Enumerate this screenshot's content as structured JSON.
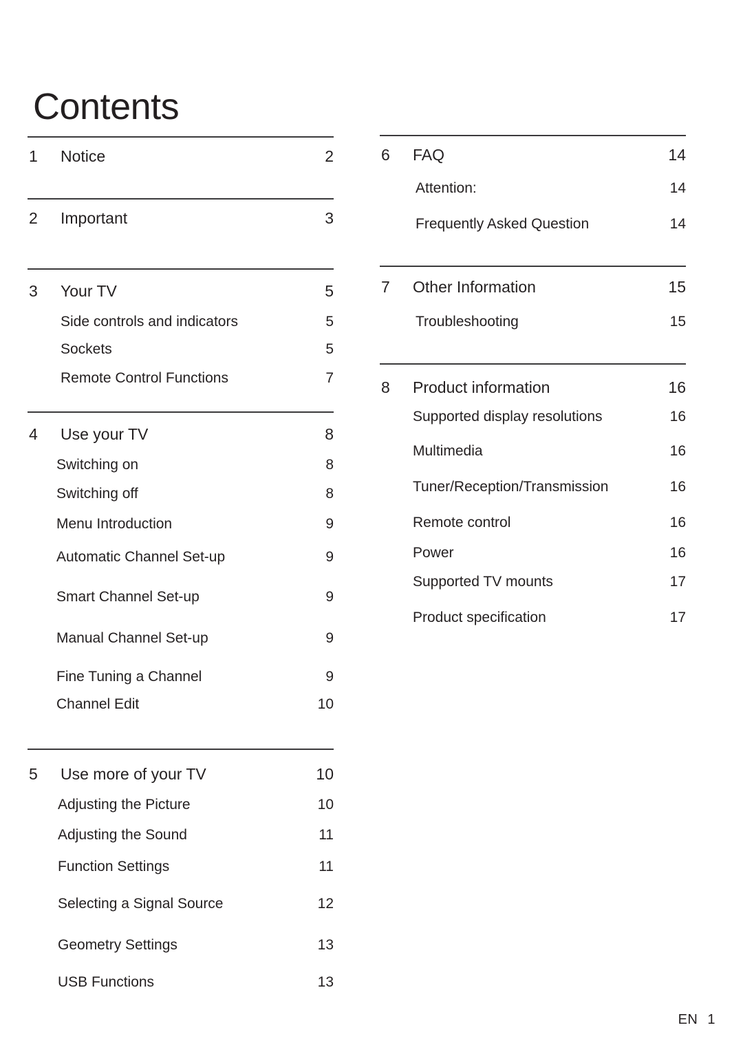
{
  "document": {
    "title": "Contents"
  },
  "footer": {
    "language_code": "EN",
    "page_number": "1"
  },
  "toc": {
    "left_column": [
      {
        "number": "1",
        "label": "Notice",
        "page": "2",
        "children": []
      },
      {
        "number": "2",
        "label": "Important",
        "page": "3",
        "children": []
      },
      {
        "number": "3",
        "label": "Your  TV",
        "page": "5",
        "children": [
          {
            "label": "Side controls and indicators",
            "page": "5"
          },
          {
            "label": "Sockets",
            "page": "5"
          },
          {
            "label": "Remote Control Functions",
            "page": "7"
          }
        ]
      },
      {
        "number": "4",
        "label": "Use your TV",
        "page": "8",
        "children": [
          {
            "label": "Switching on",
            "page": "8"
          },
          {
            "label": "Switching off",
            "page": "8"
          },
          {
            "label": "Menu Introduction",
            "page": "9"
          },
          {
            "label": "Automatic Channel Set-up",
            "page": "9"
          },
          {
            "label": "Smart Channel Set-up",
            "page": "9"
          },
          {
            "label": "Manual Channel Set-up",
            "page": "9"
          },
          {
            "label": "Fine Tuning a Channel",
            "page": "9"
          },
          {
            "label": "Channel Edit",
            "page": "10"
          }
        ]
      },
      {
        "number": "5",
        "label": "Use more of your TV",
        "page": "10",
        "children": [
          {
            "label": "Adjusting the Picture",
            "page": "10"
          },
          {
            "label": "Adjusting the Sound",
            "page": "11"
          },
          {
            "label": "Function Settings",
            "page": "11"
          },
          {
            "label": "Selecting a Signal Source",
            "page": "12"
          },
          {
            "label": "Geometry Settings",
            "page": "13"
          },
          {
            "label": "USB Functions",
            "page": "13"
          }
        ]
      }
    ],
    "right_column": [
      {
        "number": "6",
        "label": "FAQ",
        "page": "14",
        "children": [
          {
            "label": "Attention:",
            "page": "14"
          },
          {
            "label": "Frequently Asked Question",
            "page": "14"
          }
        ]
      },
      {
        "number": "7",
        "label": "Other Information",
        "page": "15",
        "children": [
          {
            "label": "Troubleshooting",
            "page": "15"
          }
        ]
      },
      {
        "number": "8",
        "label": "Product information",
        "page": "16",
        "children": [
          {
            "label": "Supported display resolutions",
            "page": "16"
          },
          {
            "label": "Multimedia",
            "page": "16"
          },
          {
            "label": "Tuner/Reception/Transmission",
            "page": "16"
          },
          {
            "label": "Remote control",
            "page": "16"
          },
          {
            "label": "Power",
            "page": "16"
          },
          {
            "label": "Supported TV mounts",
            "page": "17"
          },
          {
            "label": "Product specification",
            "page": "17"
          }
        ]
      }
    ]
  }
}
